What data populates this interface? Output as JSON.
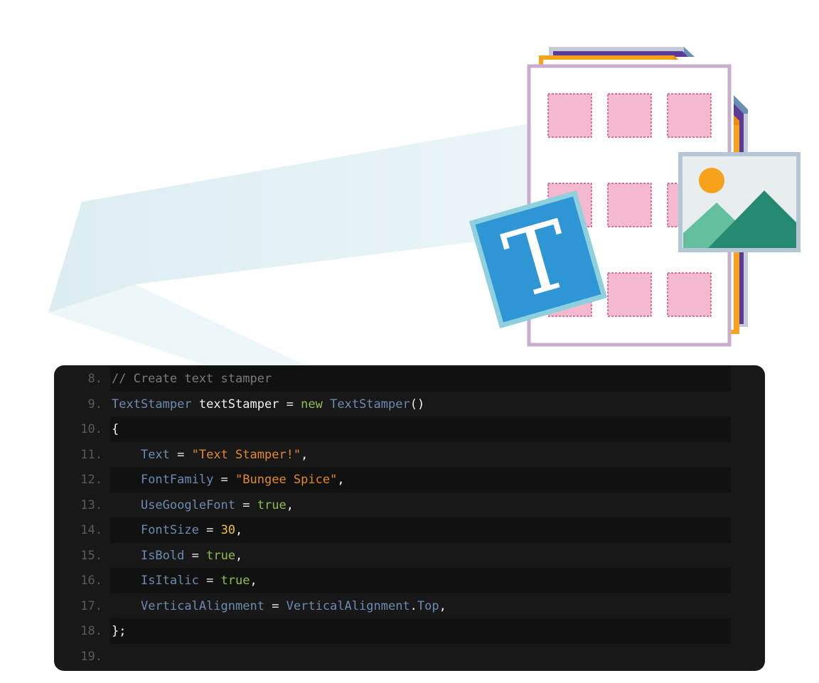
{
  "illustration": {
    "description": "Document with stacked pages, text stamp icon and image stamp icon",
    "text_icon_letter": "T",
    "colors": {
      "ribbon": "#e3f2f6",
      "page_border": "#c9aecb",
      "tile_fill": "#f4b9ce",
      "tile_dash": "#c2356a",
      "stack_purple": "#5a3c96",
      "stack_orange": "#f6a21a",
      "stack_gray": "#c6cad8",
      "stack_fold": "#6a8fb5",
      "text_icon_fill": "#2e96d4",
      "text_icon_border": "#8fd0de",
      "image_bg": "#e8edf0",
      "image_border": "#b4c6d6",
      "sun": "#f6a21a",
      "mountain_light": "#64bf9e",
      "mountain_dark": "#268a72"
    }
  },
  "code": {
    "background": "#181818",
    "stripe": "#111111",
    "lines": [
      {
        "n": "8.",
        "tokens": [
          {
            "t": "// Create text stamper",
            "c": "comment"
          }
        ]
      },
      {
        "n": "9.",
        "tokens": [
          {
            "t": "TextStamper",
            "c": "type"
          },
          {
            "t": " ",
            "c": "op"
          },
          {
            "t": "textStamper",
            "c": "ident"
          },
          {
            "t": " = ",
            "c": "op"
          },
          {
            "t": "new",
            "c": "kw"
          },
          {
            "t": " ",
            "c": "op"
          },
          {
            "t": "TextStamper",
            "c": "type"
          },
          {
            "t": "()",
            "c": "punct"
          }
        ]
      },
      {
        "n": "10.",
        "tokens": [
          {
            "t": "{",
            "c": "punct"
          }
        ]
      },
      {
        "n": "11.",
        "tokens": [
          {
            "t": "    ",
            "c": "op"
          },
          {
            "t": "Text",
            "c": "prop"
          },
          {
            "t": " = ",
            "c": "op"
          },
          {
            "t": "\"Text Stamper!\"",
            "c": "str"
          },
          {
            "t": ",",
            "c": "punct"
          }
        ]
      },
      {
        "n": "12.",
        "tokens": [
          {
            "t": "    ",
            "c": "op"
          },
          {
            "t": "FontFamily",
            "c": "prop"
          },
          {
            "t": " = ",
            "c": "op"
          },
          {
            "t": "\"Bungee Spice\"",
            "c": "str"
          },
          {
            "t": ",",
            "c": "punct"
          }
        ]
      },
      {
        "n": "13.",
        "tokens": [
          {
            "t": "    ",
            "c": "op"
          },
          {
            "t": "UseGoogleFont",
            "c": "prop"
          },
          {
            "t": " = ",
            "c": "op"
          },
          {
            "t": "true",
            "c": "kw"
          },
          {
            "t": ",",
            "c": "punct"
          }
        ]
      },
      {
        "n": "14.",
        "tokens": [
          {
            "t": "    ",
            "c": "op"
          },
          {
            "t": "FontSize",
            "c": "prop"
          },
          {
            "t": " = ",
            "c": "op"
          },
          {
            "t": "30",
            "c": "num"
          },
          {
            "t": ",",
            "c": "punct"
          }
        ]
      },
      {
        "n": "15.",
        "tokens": [
          {
            "t": "    ",
            "c": "op"
          },
          {
            "t": "IsBold",
            "c": "prop"
          },
          {
            "t": " = ",
            "c": "op"
          },
          {
            "t": "true",
            "c": "kw"
          },
          {
            "t": ",",
            "c": "punct"
          }
        ]
      },
      {
        "n": "16.",
        "tokens": [
          {
            "t": "    ",
            "c": "op"
          },
          {
            "t": "IsItalic",
            "c": "prop"
          },
          {
            "t": " = ",
            "c": "op"
          },
          {
            "t": "true",
            "c": "kw"
          },
          {
            "t": ",",
            "c": "punct"
          }
        ]
      },
      {
        "n": "17.",
        "tokens": [
          {
            "t": "    ",
            "c": "op"
          },
          {
            "t": "VerticalAlignment",
            "c": "prop"
          },
          {
            "t": " = ",
            "c": "op"
          },
          {
            "t": "VerticalAlignment",
            "c": "type"
          },
          {
            "t": ".",
            "c": "punct"
          },
          {
            "t": "Top",
            "c": "type"
          },
          {
            "t": ",",
            "c": "punct"
          }
        ]
      },
      {
        "n": "18.",
        "tokens": [
          {
            "t": "};",
            "c": "punct"
          }
        ]
      },
      {
        "n": "19.",
        "tokens": []
      }
    ]
  }
}
